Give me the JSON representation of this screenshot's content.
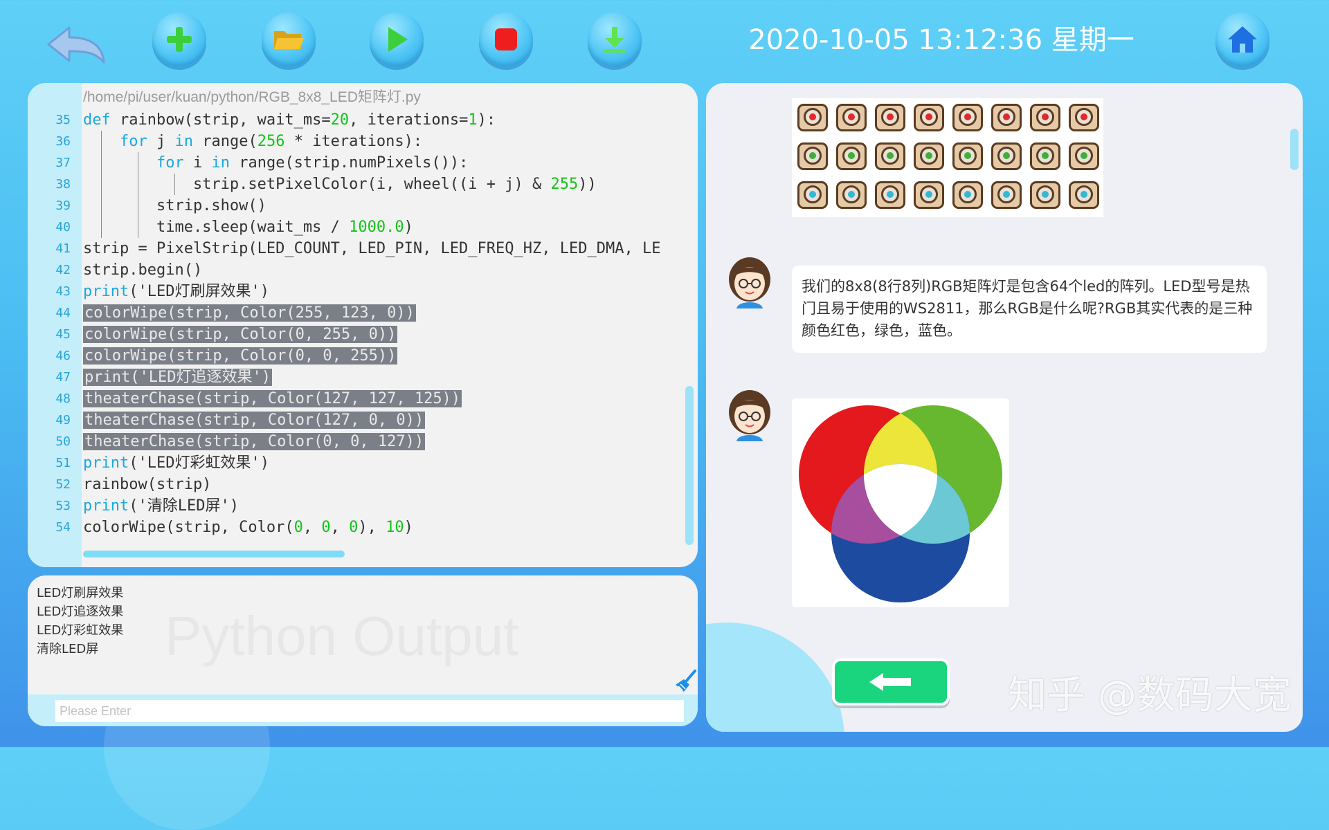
{
  "toolbar": {
    "datetime": "2020-10-05 13:12:36 星期一",
    "buttons": [
      "back",
      "add",
      "open-folder",
      "run",
      "stop",
      "download",
      "home"
    ]
  },
  "editor": {
    "file_path": "/home/pi/user/kuan/python/RGB_8x8_LED矩阵灯.py",
    "lines": [
      {
        "n": "35",
        "t": "def rainbow(strip, wait_ms=20, iterations=1):"
      },
      {
        "n": "36",
        "t": "    for j in range(256 * iterations):"
      },
      {
        "n": "37",
        "t": "        for i in range(strip.numPixels()):"
      },
      {
        "n": "38",
        "t": "            strip.setPixelColor(i, wheel((i + j) & 255))"
      },
      {
        "n": "39",
        "t": "        strip.show()"
      },
      {
        "n": "40",
        "t": "        time.sleep(wait_ms / 1000.0)"
      },
      {
        "n": "41",
        "t": "strip = PixelStrip(LED_COUNT, LED_PIN, LED_FREQ_HZ, LED_DMA, LE"
      },
      {
        "n": "42",
        "t": "strip.begin()"
      },
      {
        "n": "43",
        "t": "print('LED灯刷屏效果')"
      },
      {
        "n": "44",
        "t": "colorWipe(strip, Color(255, 123, 0))"
      },
      {
        "n": "45",
        "t": "colorWipe(strip, Color(0, 255, 0))"
      },
      {
        "n": "46",
        "t": "colorWipe(strip, Color(0, 0, 255))"
      },
      {
        "n": "47",
        "t": "print('LED灯追逐效果')"
      },
      {
        "n": "48",
        "t": "theaterChase(strip, Color(127, 127, 125))"
      },
      {
        "n": "49",
        "t": "theaterChase(strip, Color(127, 0, 0))"
      },
      {
        "n": "50",
        "t": "theaterChase(strip, Color(0, 0, 127))"
      },
      {
        "n": "51",
        "t": "print('LED灯彩虹效果')"
      },
      {
        "n": "52",
        "t": "rainbow(strip)"
      },
      {
        "n": "53",
        "t": "print('清除LED屏')"
      },
      {
        "n": "54",
        "t": "colorWipe(strip, Color(0, 0, 0), 10)"
      }
    ]
  },
  "output": {
    "lines": [
      "LED灯刷屏效果",
      "LED灯追逐效果",
      "LED灯彩虹效果",
      "清除LED屏"
    ],
    "watermark": "Python Output",
    "input_placeholder": "Please Enter"
  },
  "chat": {
    "message": "我们的8x8(8行8列)RGB矩阵灯是包含64个led的阵列。LED型号是热门且易于使用的WS2811，那么RGB是什么呢?RGB其实代表的是三种颜色红色，绿色，蓝色。",
    "led_dot_colors": [
      "#e02a2a",
      "#3fae3a",
      "#36b7d6"
    ]
  },
  "watermark": "知乎 @数码大宽",
  "colors": {
    "accent": "#4fc6f5",
    "keyword": "#19a9dc",
    "number": "#11c417",
    "selection": "#7b8088",
    "green_button": "#1ad57e"
  }
}
